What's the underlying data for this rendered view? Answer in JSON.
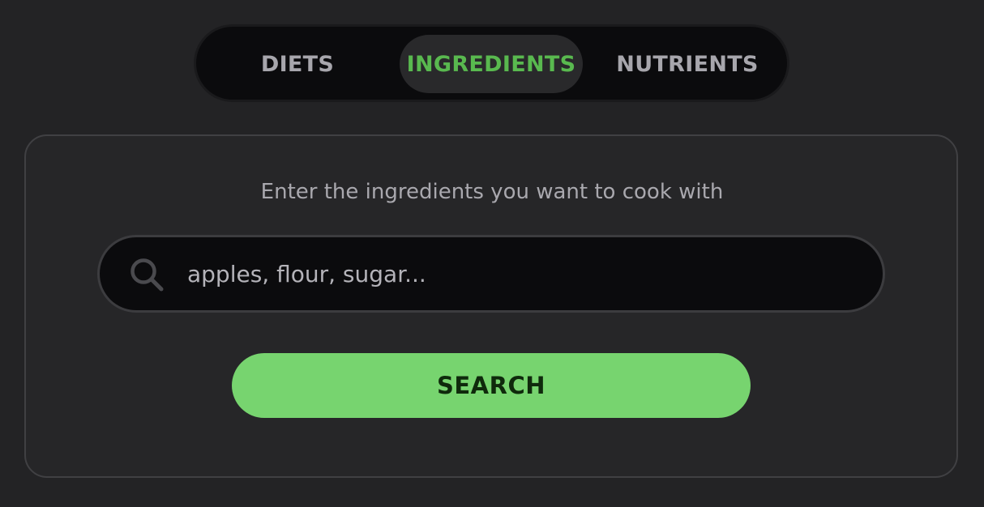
{
  "tabs": {
    "items": [
      {
        "label": "DIETS"
      },
      {
        "label": "INGREDIENTS"
      },
      {
        "label": "NUTRIENTS"
      }
    ],
    "selected": "INGREDIENTS"
  },
  "ingredients_panel": {
    "prompt": "Enter the ingredients you want to cook with",
    "search": {
      "placeholder": "apples, flour, sugar...",
      "value": "",
      "icon": "search-icon"
    },
    "button_label": "SEARCH"
  },
  "colors": {
    "background": "#232325",
    "accent_green": "#77d46f",
    "active_tab_text": "#59b94f",
    "inactive_tab_text": "#a7a6ac",
    "button_text": "#0f2a0c"
  }
}
